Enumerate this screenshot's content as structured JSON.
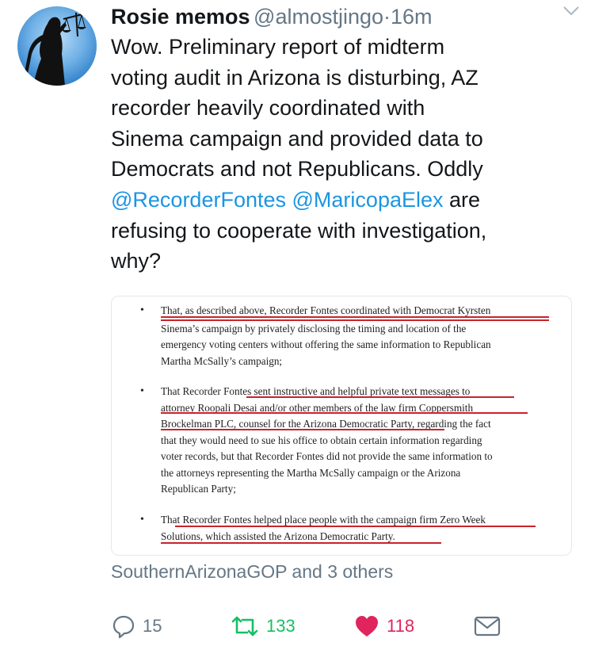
{
  "tweet": {
    "author_name": "Rosie memos",
    "handle": "@almostjingo",
    "separator": "·",
    "time": "16m",
    "text": {
      "line1": "Wow. Preliminary report of midterm",
      "line2": "voting audit in Arizona is disturbing, AZ",
      "line3": "recorder heavily coordinated with",
      "line4": "Sinema campaign and provided data to",
      "line5": "Democrats and not Republicans. Oddly",
      "mention1": "@RecorderFontes",
      "mention2": "@MaricopaElex",
      "line6_tail": "are",
      "line7": "refusing to cooperate with investigation,",
      "line8": "why?"
    },
    "attached_document": {
      "bullet_glyph": "•",
      "items": [
        {
          "lines": [
            "That, as described above, Recorder Fontes coordinated with Democrat Kyrsten",
            "Sinema’s campaign by privately disclosing the timing and location of the",
            "emergency voting centers without offering the same information to Republican",
            "Martha McSally’s campaign;"
          ]
        },
        {
          "lines": [
            "That Recorder Fontes sent instructive and helpful private text messages to",
            "attorney Roopali Desai and/or other members of the law firm Coppersmith",
            "Brockelman PLC, counsel for the Arizona Democratic Party, regarding the fact",
            "that they would need to sue his office to obtain certain information regarding",
            "voter records, but that Recorder Fontes did not provide the same information to",
            "the attorneys representing the Martha McSally campaign or the Arizona",
            "Republican Party;"
          ]
        },
        {
          "lines": [
            "That Recorder Fontes helped place people with the campaign firm Zero Week",
            "Solutions, which assisted the Arizona Democratic Party."
          ]
        }
      ]
    },
    "liked_by": "SouthernArizonaGOP and 3 others",
    "actions": {
      "reply_count": "15",
      "retweet_count": "133",
      "like_count": "118"
    },
    "colors": {
      "text": "#14171a",
      "secondary": "#657786",
      "link": "#1b95e0",
      "retweet_active": "#17bf63",
      "like_active": "#e0245e",
      "underline": "#c8232c"
    }
  }
}
